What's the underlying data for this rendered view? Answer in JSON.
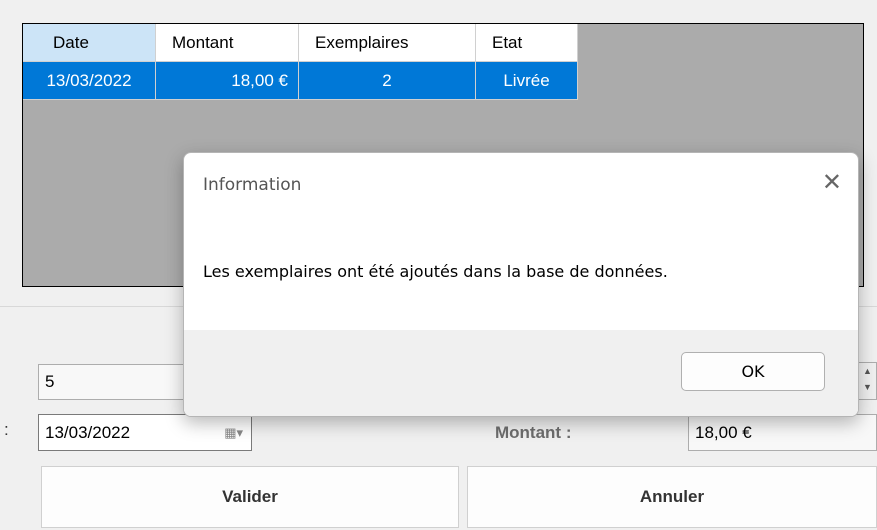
{
  "grid": {
    "columns": [
      "Date",
      "Montant",
      "Exemplaires",
      "Etat"
    ],
    "rows": [
      {
        "date": "13/03/2022",
        "montant": "18,00 €",
        "exemplaires": "2",
        "etat": "Livrée"
      }
    ]
  },
  "form": {
    "quantity": "5",
    "date": "13/03/2022",
    "colon": ":",
    "montant_label": "Montant :",
    "montant_value": "18,00 €",
    "valider_label": "Valider",
    "annuler_label": "Annuler"
  },
  "dialog": {
    "title": "Information",
    "close_glyph": "✕",
    "message": "Les exemplaires ont été ajoutés dans la base de données.",
    "ok_label": "OK"
  },
  "colors": {
    "selection": "#0078d7",
    "header_selected": "#cce4f7",
    "grid_background": "#ababab"
  }
}
